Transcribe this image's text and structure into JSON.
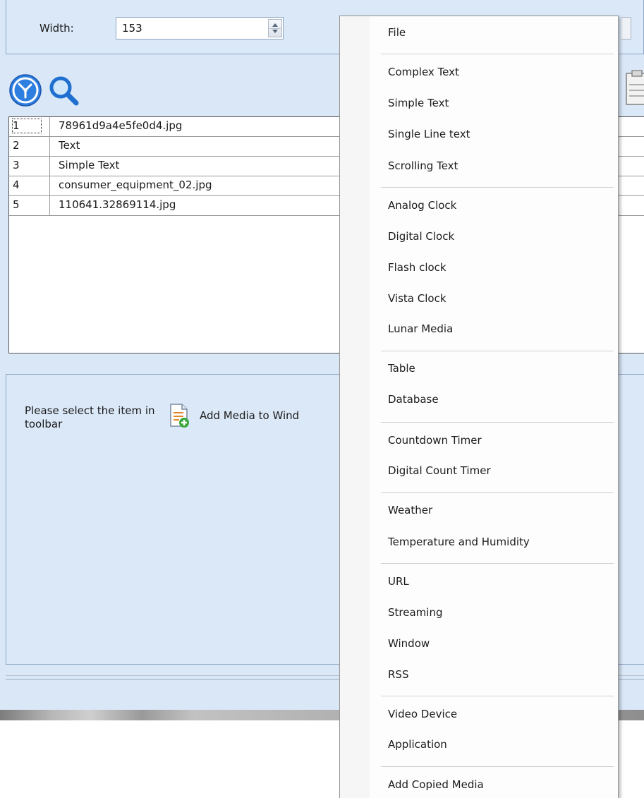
{
  "width_field": {
    "label": "Width:",
    "value": "153"
  },
  "toolbar": {
    "clock_icon": "analog-clock-icon",
    "search_icon": "magnifier-icon",
    "paste_icon": "clipboard-icon"
  },
  "media_list": {
    "rows": [
      {
        "index": "1",
        "name": "78961d9a4e5fe0d4.jpg"
      },
      {
        "index": "2",
        "name": "Text"
      },
      {
        "index": "3",
        "name": "Simple Text"
      },
      {
        "index": "4",
        "name": "consumer_equipment_02.jpg"
      },
      {
        "index": "5",
        "name": "110641.32869114.jpg"
      }
    ]
  },
  "lower_panel": {
    "hint": "Please select the item in toolbar",
    "add_media_label": "Add Media to Wind"
  },
  "context_menu": {
    "items": [
      "File",
      "Complex Text",
      "Simple Text",
      "Single Line text",
      "Scrolling Text",
      "Analog Clock",
      "Digital Clock",
      "Flash clock",
      "Vista Clock",
      "Lunar Media",
      "Table",
      "Database",
      "Countdown Timer",
      "Digital Count Timer",
      "Weather",
      "Temperature and Humidity",
      "URL",
      "Streaming",
      "Window",
      "RSS",
      "Video Device",
      "Application",
      "Add Copied Media"
    ]
  },
  "colors": {
    "app_background": "#d9e7f7",
    "clock_blue": "#2f7fe0",
    "menu_background": "#fdfdfd"
  }
}
